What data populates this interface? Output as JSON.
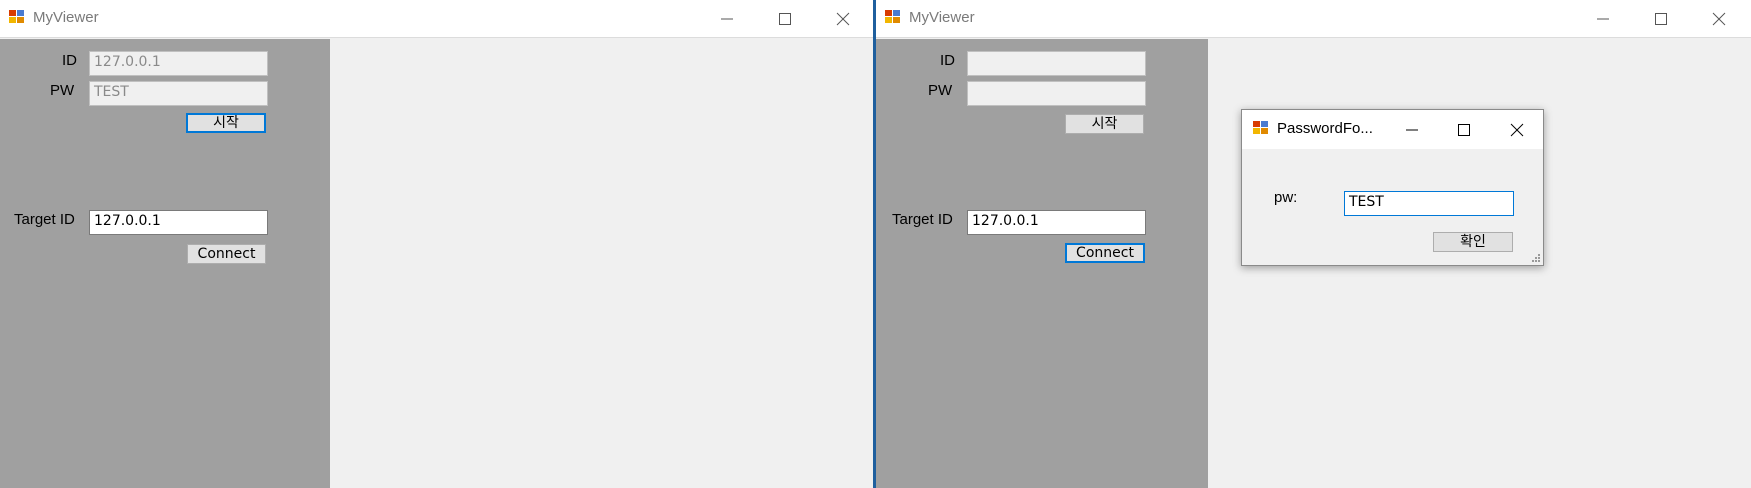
{
  "colors": {
    "sidebar": "#a0a0a0",
    "accent": "#0078d7",
    "divider": "#1f5f9e"
  },
  "windows": [
    {
      "title": "MyViewer",
      "icon": "app-window-icon",
      "id_label": "ID",
      "id_value": "127.0.0.1",
      "pw_label": "PW",
      "pw_value": "TEST",
      "start_button": "시작",
      "target_label": "Target ID",
      "target_value": "127.0.0.1",
      "connect_button": "Connect"
    },
    {
      "title": "MyViewer",
      "icon": "app-window-icon",
      "id_label": "ID",
      "id_value": "",
      "pw_label": "PW",
      "pw_value": "",
      "start_button": "시작",
      "target_label": "Target ID",
      "target_value": "127.0.0.1",
      "connect_button": "Connect"
    }
  ],
  "dialog": {
    "title": "PasswordFo...",
    "pw_label": "pw:",
    "pw_value": "TEST",
    "ok_button": "확인"
  }
}
